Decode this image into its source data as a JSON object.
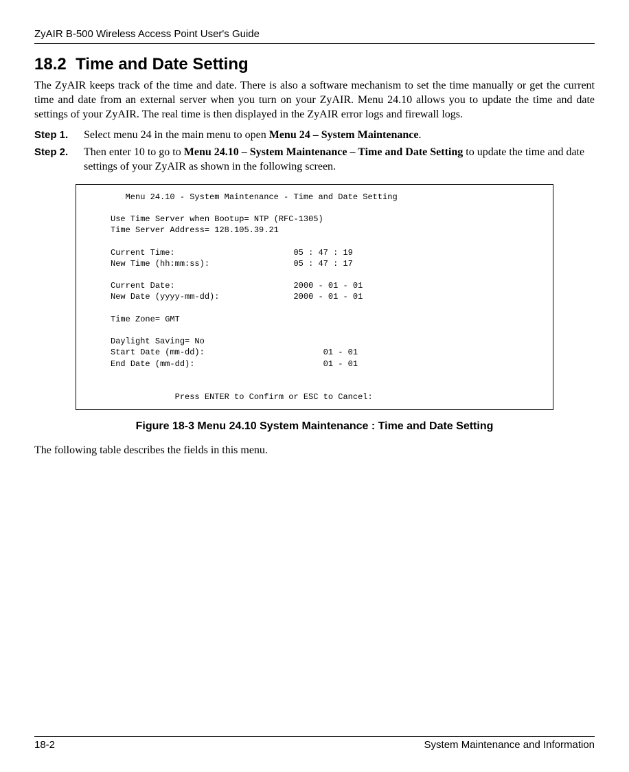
{
  "header": {
    "title": "ZyAIR B-500 Wireless Access Point User's Guide"
  },
  "section": {
    "number": "18.2",
    "title": "Time and Date Setting",
    "intro": " The ZyAIR keeps track of the time and date. There is also a software mechanism to set the time manually or get the current time and date from an external server when you turn on your ZyAIR. Menu 24.10 allows you to update the time and date settings of your ZyAIR. The real time is then displayed in the ZyAIR error logs and firewall logs."
  },
  "steps": [
    {
      "label": "Step 1.",
      "pre": "Select menu 24 in the main menu to open ",
      "bold": "Menu 24 – System Maintenance",
      "post": "."
    },
    {
      "label": "Step 2.",
      "pre": "Then enter 10 to go to ",
      "bold": "Menu 24.10 – System Maintenance – Time and Date Setting",
      "post": " to update the time and date settings of your ZyAIR as shown in the following screen."
    }
  ],
  "terminal": {
    "title": "Menu 24.10 - System Maintenance - Time and Date Setting",
    "line_useserver": "Use Time Server when Bootup= NTP (RFC-1305)",
    "line_serveraddr": "Time Server Address= 128.105.39.21",
    "curtime_label": "Current Time:",
    "curtime_value": "05 : 47 : 19",
    "newtime_label": "New Time (hh:mm:ss):",
    "newtime_value": "05 : 47 : 17",
    "curdate_label": "Current Date:",
    "curdate_value": "2000 - 01 - 01",
    "newdate_label": "New Date (yyyy-mm-dd):",
    "newdate_value": "2000 - 01 - 01",
    "tz": "Time Zone= GMT",
    "daylight": "Daylight Saving= No",
    "startdate_label": "Start Date (mm-dd):",
    "startdate_value": "01 - 01",
    "enddate_label": "End Date (mm-dd):",
    "enddate_value": "01 - 01",
    "prompt": "Press ENTER to Confirm or ESC to Cancel:"
  },
  "figure_caption": "Figure 18-3 Menu 24.10 System Maintenance : Time and Date Setting",
  "closing": "The following table describes the fields in this menu.",
  "footer": {
    "left": "18-2",
    "right": "System Maintenance and Information"
  }
}
